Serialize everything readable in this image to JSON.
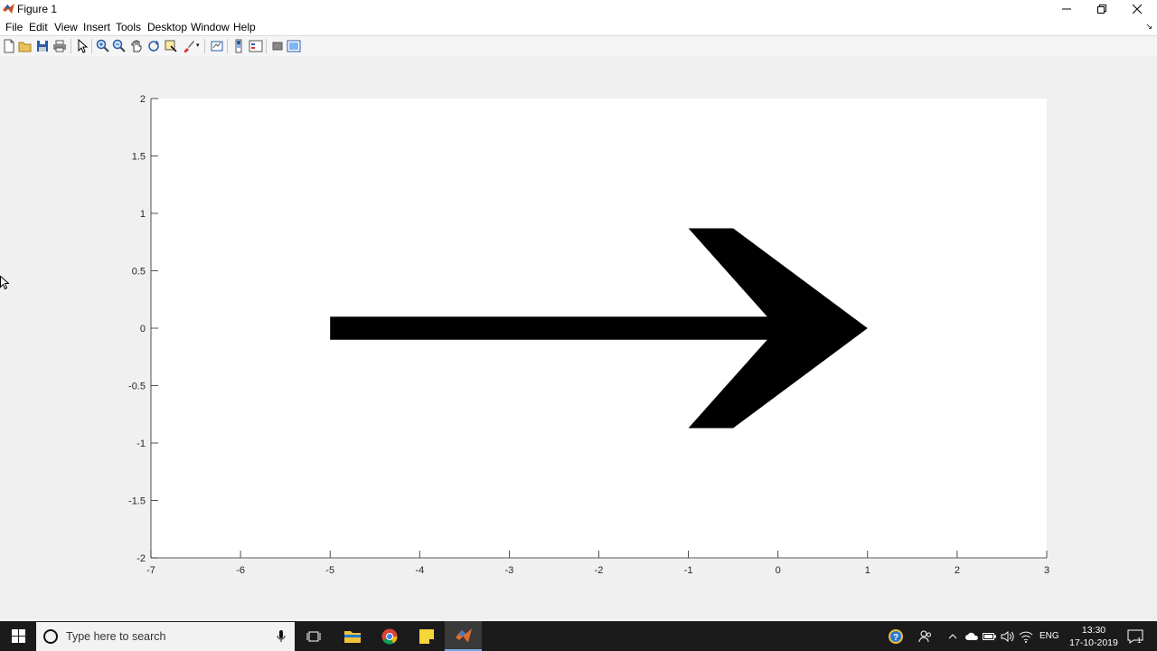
{
  "window": {
    "title": "Figure 1",
    "icon": "matlab-icon",
    "controls": [
      "minimize-icon",
      "restore-icon",
      "close-icon"
    ]
  },
  "menu": {
    "items": [
      "File",
      "Edit",
      "View",
      "Insert",
      "Tools",
      "Desktop",
      "Window",
      "Help"
    ]
  },
  "toolbar": {
    "icons": [
      "new-figure-icon",
      "open-file-icon",
      "save-icon",
      "print-icon",
      "edit-plot-icon",
      "zoom-in-icon",
      "zoom-out-icon",
      "pan-icon",
      "rotate-3d-icon",
      "data-cursor-icon",
      "brush-icon",
      "link-plot-icon",
      "colorbar-icon",
      "legend-icon",
      "hide-plot-tools-icon",
      "show-plot-tools-icon"
    ]
  },
  "chart_data": {
    "type": "area",
    "title": "",
    "xlabel": "",
    "ylabel": "",
    "xlim": [
      -7,
      3
    ],
    "ylim": [
      -2,
      2
    ],
    "xticks": [
      -7,
      -6,
      -5,
      -4,
      -3,
      -2,
      -1,
      0,
      1,
      2,
      3
    ],
    "yticks": [
      -2,
      -1.5,
      -1,
      -0.5,
      0,
      0.5,
      1,
      1.5,
      2
    ],
    "xtick_labels": [
      "-7",
      "-6",
      "-5",
      "-4",
      "-3",
      "-2",
      "-1",
      "0",
      "1",
      "2",
      "3"
    ],
    "ytick_labels": [
      "-2",
      "-1.5",
      "-1",
      "-0.5",
      "0",
      "0.5",
      "1",
      "1.5",
      "2"
    ],
    "grid": false,
    "series": [
      {
        "fill": "#000000",
        "x": [
          -5,
          -0.12,
          -1,
          -0.5,
          1,
          -0.5,
          -1,
          -0.12,
          -5
        ],
        "y": [
          0.1,
          0.1,
          0.87,
          0.87,
          0,
          -0.87,
          -0.87,
          -0.1,
          -0.1
        ]
      }
    ]
  },
  "taskbar": {
    "search_placeholder": "Type here to search",
    "apps": [
      "task-view-icon",
      "file-explorer-icon",
      "chrome-icon",
      "sticky-notes-icon",
      "matlab-taskbar-icon"
    ],
    "tray": [
      "help-icon",
      "people-icon",
      "chevron-up-icon",
      "onedrive-icon",
      "battery-icon",
      "volume-icon",
      "wifi-icon"
    ],
    "lang": "ENG",
    "time": "13:30",
    "date": "17-10-2019",
    "notification_count": "1"
  }
}
